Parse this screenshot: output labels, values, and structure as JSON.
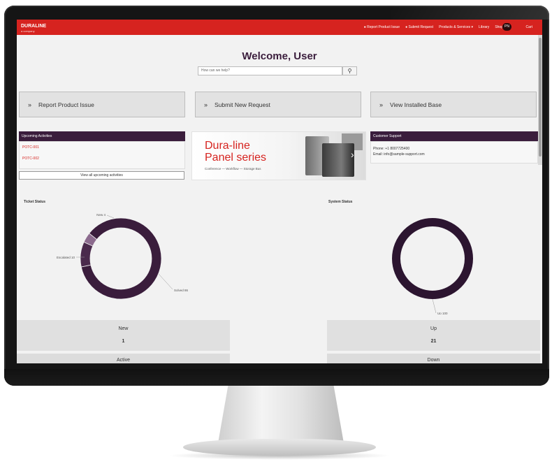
{
  "header": {
    "logo": "DURALINE",
    "logo_sub": "a company",
    "nav": [
      "Report Product Issue",
      "Submit Request",
      "Products & Services",
      "Library",
      "Shop"
    ],
    "avatar": "PN",
    "last": "Cart"
  },
  "main": {
    "welcome": "Welcome, User",
    "search_placeholder": "How can we help?",
    "actions": [
      {
        "label": "Report Product Issue"
      },
      {
        "label": "Submit New Request"
      },
      {
        "label": "View Installed Base"
      }
    ]
  },
  "activities": {
    "title": "Upcoming Activities",
    "items": [
      "POTC-001",
      "POTC-002"
    ],
    "view_all": "View all upcoming activities"
  },
  "banner": {
    "line1": "Dura-line",
    "line2": "Panel series",
    "caption": "Conference — Workflow — Storage Bus"
  },
  "support": {
    "title": "Customer Support",
    "phone": "Phone: +1 8007725400",
    "email": "Email: info@sample-support.com"
  },
  "charts": [
    {
      "title": "Ticket Status",
      "chart_data": {
        "type": "pie",
        "categories": [
          "Solved",
          "Escalated",
          "New"
        ],
        "values": [
          86,
          10,
          4
        ],
        "colors": [
          "#3a1d3c",
          "#4a2a4c",
          "#8c6b8e"
        ]
      }
    },
    {
      "title": "System Status",
      "chart_data": {
        "type": "pie",
        "categories": [
          "Up"
        ],
        "values": [
          100
        ],
        "colors": [
          "#2c1530"
        ]
      }
    }
  ],
  "stats": [
    {
      "label": "New",
      "value": "1"
    },
    {
      "label": "Up",
      "value": "21"
    },
    {
      "label": "Active"
    },
    {
      "label": "Down"
    }
  ]
}
